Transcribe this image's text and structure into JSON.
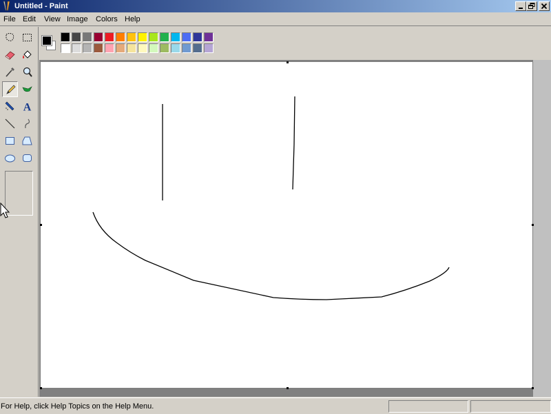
{
  "window": {
    "title": "Untitled - Paint",
    "controls": [
      "minimize",
      "restore",
      "close"
    ]
  },
  "menu": {
    "items": [
      "File",
      "Edit",
      "View",
      "Image",
      "Colors",
      "Help"
    ]
  },
  "tools": [
    {
      "name": "free-form-select-icon"
    },
    {
      "name": "select-icon"
    },
    {
      "name": "eraser-icon"
    },
    {
      "name": "fill-with-color-icon"
    },
    {
      "name": "pick-color-icon"
    },
    {
      "name": "magnifier-icon"
    },
    {
      "name": "pencil-icon",
      "selected": true
    },
    {
      "name": "brush-icon"
    },
    {
      "name": "airbrush-icon"
    },
    {
      "name": "text-icon",
      "glyph": "A"
    },
    {
      "name": "line-icon"
    },
    {
      "name": "curve-icon"
    },
    {
      "name": "rectangle-icon"
    },
    {
      "name": "polygon-icon"
    },
    {
      "name": "ellipse-icon"
    },
    {
      "name": "rounded-rectangle-icon"
    }
  ],
  "palette": {
    "foreground": "#000000",
    "background": "#ffffff",
    "row1": [
      "#000000",
      "#464646",
      "#787878",
      "#990030",
      "#ed1c24",
      "#ff7e00",
      "#ffc20e",
      "#fff200",
      "#a8e61d",
      "#22b14c",
      "#00b7ef",
      "#4d6df3",
      "#2f3699",
      "#6f3198"
    ],
    "row2": [
      "#ffffff",
      "#dcdcdc",
      "#b4b4b4",
      "#9c5a3c",
      "#ffa3b1",
      "#e5aa7a",
      "#f5e49c",
      "#fff9bd",
      "#d3f9bc",
      "#9dbb61",
      "#99d9ea",
      "#709ad1",
      "#546d8e",
      "#b5a5d5"
    ]
  },
  "status": {
    "help_text": "For Help, click Help Topics on the Help Menu."
  }
}
